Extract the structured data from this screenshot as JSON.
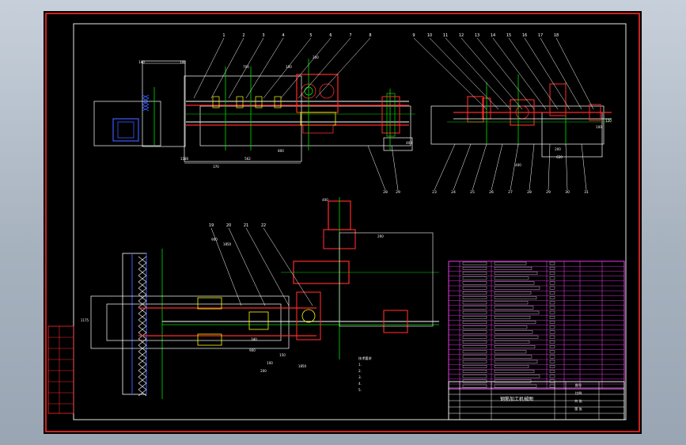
{
  "drawing": {
    "colors": {
      "frame": "#ff2a2a",
      "line": "#ffffff",
      "green": "#00e000",
      "yellow": "#ffff00",
      "magenta": "#ff40ff",
      "blue": "#3a5cff",
      "background": "#000000"
    },
    "balloons_top_left": [
      "1",
      "2",
      "3",
      "4",
      "5",
      "6",
      "7",
      "8"
    ],
    "balloons_top_right": [
      "9",
      "10",
      "11",
      "12",
      "13",
      "14",
      "15",
      "16",
      "17",
      "18"
    ],
    "balloons_bottom": [
      "19",
      "20",
      "21",
      "22"
    ],
    "dims_top": [
      "180",
      "100",
      "700",
      "100",
      "200",
      "1180",
      "370",
      "562",
      "800",
      "400"
    ],
    "dims_top_right": [
      "400",
      "620",
      "200",
      "120",
      "100"
    ],
    "dims_bottom": [
      "900",
      "1850",
      "340",
      "1175",
      "900",
      "150",
      "100",
      "200",
      "1850",
      "400",
      "200"
    ],
    "title_block": {
      "name": "钢筋加工机械图",
      "cells": [
        "图号",
        "比例",
        "共 张",
        "第 张"
      ]
    },
    "notes": [
      "技术要求",
      "1.",
      "2.",
      "3.",
      "4.",
      "5."
    ]
  }
}
